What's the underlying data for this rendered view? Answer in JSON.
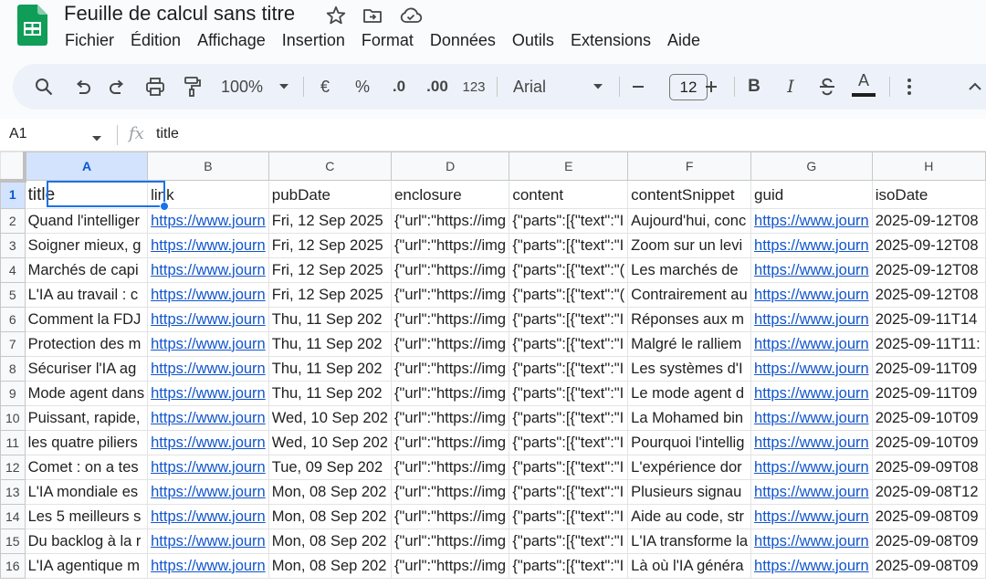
{
  "app": {
    "doc_title": "Feuille de calcul sans titre",
    "menus": [
      "Fichier",
      "Édition",
      "Affichage",
      "Insertion",
      "Format",
      "Données",
      "Outils",
      "Extensions",
      "Aide"
    ]
  },
  "toolbar": {
    "zoom": "100%",
    "currency": "€",
    "percent": "%",
    "decrease_decimals": ".0",
    "increase_decimals": ".00",
    "number_format": "123",
    "font": "Arial",
    "font_size": "12",
    "bold": "B",
    "italic": "I",
    "text_color": "A"
  },
  "formula_bar": {
    "cell_ref": "A1",
    "fx": "fx",
    "content": "title"
  },
  "grid": {
    "columns": [
      "A",
      "B",
      "C",
      "D",
      "E",
      "F",
      "G",
      "H"
    ],
    "selected_column": "A",
    "rows": [
      {
        "n": "1",
        "cells": [
          "title",
          "link",
          "pubDate",
          "enclosure",
          "content",
          "contentSnippet",
          "guid",
          "isoDate"
        ]
      },
      {
        "n": "2",
        "cells": [
          "Quand l'intelliger",
          "https://www.journ",
          "Fri, 12 Sep 2025",
          "{\"url\":\"https://img",
          "{\"parts\":[{\"text\":\"I",
          "Aujourd'hui, conc",
          "https://www.journ",
          "2025-09-12T08"
        ]
      },
      {
        "n": "3",
        "cells": [
          "Soigner mieux, g",
          "https://www.journ",
          "Fri, 12 Sep 2025",
          "{\"url\":\"https://img",
          "{\"parts\":[{\"text\":\"I",
          "Zoom sur un levi",
          "https://www.journ",
          "2025-09-12T08"
        ]
      },
      {
        "n": "4",
        "cells": [
          "Marchés de capi",
          "https://www.journ",
          "Fri, 12 Sep 2025",
          "{\"url\":\"https://img",
          "{\"parts\":[{\"text\":\"(",
          "Les marchés de",
          "https://www.journ",
          "2025-09-12T08"
        ]
      },
      {
        "n": "5",
        "cells": [
          "L'IA au travail : c",
          "https://www.journ",
          "Fri, 12 Sep 2025",
          "{\"url\":\"https://img",
          "{\"parts\":[{\"text\":\"(",
          "Contrairement au",
          "https://www.journ",
          "2025-09-12T08"
        ]
      },
      {
        "n": "6",
        "cells": [
          "Comment la FDJ",
          "https://www.journ",
          "Thu, 11 Sep 202",
          "{\"url\":\"https://img",
          "{\"parts\":[{\"text\":\"I",
          "Réponses aux m",
          "https://www.journ",
          "2025-09-11T14"
        ]
      },
      {
        "n": "7",
        "cells": [
          "Protection des m",
          "https://www.journ",
          "Thu, 11 Sep 202",
          "{\"url\":\"https://img",
          "{\"parts\":[{\"text\":\"I",
          "Malgré le ralliem",
          "https://www.journ",
          "2025-09-11T11:"
        ]
      },
      {
        "n": "8",
        "cells": [
          "Sécuriser l'IA ag",
          "https://www.journ",
          "Thu, 11 Sep 202",
          "{\"url\":\"https://img",
          "{\"parts\":[{\"text\":\"I",
          "Les systèmes d'I",
          "https://www.journ",
          "2025-09-11T09"
        ]
      },
      {
        "n": "9",
        "cells": [
          "Mode agent dans",
          "https://www.journ",
          "Thu, 11 Sep 202",
          "{\"url\":\"https://img",
          "{\"parts\":[{\"text\":\"I",
          "Le mode agent d",
          "https://www.journ",
          "2025-09-11T09"
        ]
      },
      {
        "n": "10",
        "cells": [
          "Puissant, rapide,",
          "https://www.journ",
          "Wed, 10 Sep 202",
          "{\"url\":\"https://img",
          "{\"parts\":[{\"text\":\"I",
          "La Mohamed bin",
          "https://www.journ",
          "2025-09-10T09"
        ]
      },
      {
        "n": "11",
        "cells": [
          "les quatre piliers",
          "https://www.journ",
          "Wed, 10 Sep 202",
          "{\"url\":\"https://img",
          "{\"parts\":[{\"text\":\"I",
          "Pourquoi l'intellig",
          "https://www.journ",
          "2025-09-10T09"
        ]
      },
      {
        "n": "12",
        "cells": [
          "Comet : on a tes",
          "https://www.journ",
          "Tue, 09 Sep 202",
          "{\"url\":\"https://img",
          "{\"parts\":[{\"text\":\"I",
          "L'expérience dor",
          "https://www.journ",
          "2025-09-09T08"
        ]
      },
      {
        "n": "13",
        "cells": [
          "L'IA mondiale es",
          "https://www.journ",
          "Mon, 08 Sep 202",
          "{\"url\":\"https://img",
          "{\"parts\":[{\"text\":\"I",
          "Plusieurs signau",
          "https://www.journ",
          "2025-09-08T12"
        ]
      },
      {
        "n": "14",
        "cells": [
          "Les 5 meilleurs s",
          "https://www.journ",
          "Mon, 08 Sep 202",
          "{\"url\":\"https://img",
          "{\"parts\":[{\"text\":\"I",
          "Aide au code, str",
          "https://www.journ",
          "2025-09-08T09"
        ]
      },
      {
        "n": "15",
        "cells": [
          "Du backlog à la r",
          "https://www.journ",
          "Mon, 08 Sep 202",
          "{\"url\":\"https://img",
          "{\"parts\":[{\"text\":\"I",
          "L'IA transforme la",
          "https://www.journ",
          "2025-09-08T09"
        ]
      },
      {
        "n": "16",
        "cells": [
          "L'IA agentique m",
          "https://www.journ",
          "Mon, 08 Sep 202",
          "{\"url\":\"https://img",
          "{\"parts\":[{\"text\":\"I",
          "Là où l'IA généra",
          "https://www.journ",
          "2025-09-08T09"
        ]
      }
    ]
  },
  "icons": [
    "sheets-logo-icon",
    "star-icon",
    "move-to-folder-icon",
    "cloud-saved-icon",
    "search-icon",
    "undo-icon",
    "redo-icon",
    "print-icon",
    "paint-format-icon",
    "dropdown-icon",
    "strikethrough-icon",
    "more-vert-icon",
    "collapse-icon"
  ],
  "colors": {
    "accent": "#1a73e8",
    "link": "#1155cc",
    "selected_header_bg": "#d3e3fd",
    "sheets_green": "#0f9d58"
  }
}
